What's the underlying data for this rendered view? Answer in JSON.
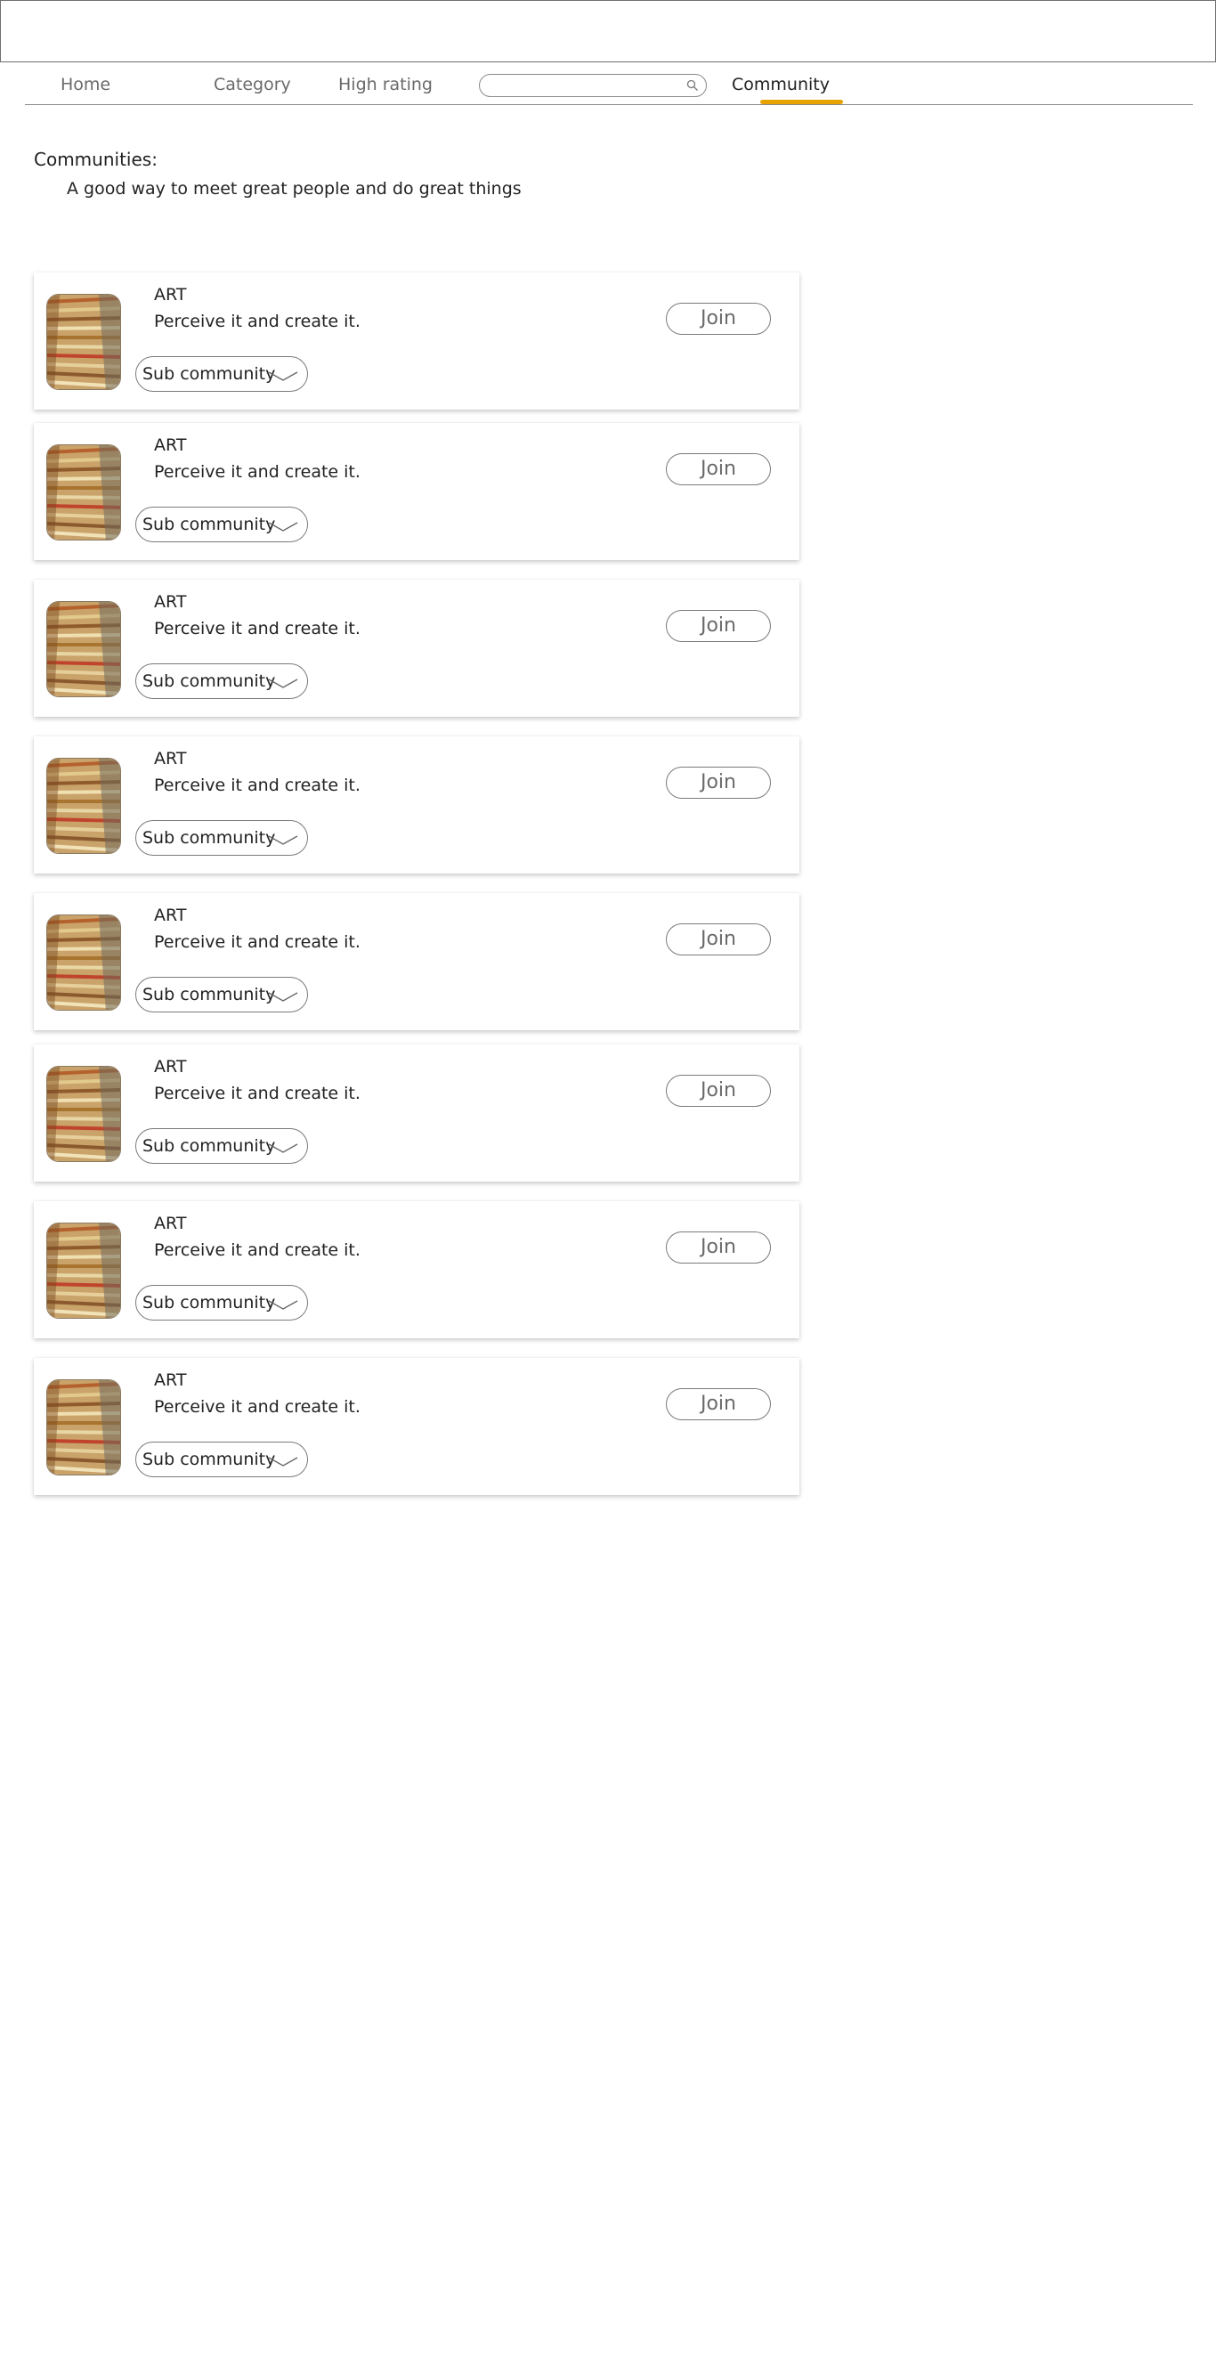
{
  "nav": {
    "items": [
      {
        "label": "Home",
        "active": false
      },
      {
        "label": "Category",
        "active": false
      },
      {
        "label": "High rating",
        "active": false
      },
      {
        "label": "Community",
        "active": true
      }
    ],
    "search": {
      "placeholder": "",
      "value": ""
    },
    "accent_color": "#e8a300"
  },
  "main": {
    "heading": "Communities:",
    "subheading": "A good way to meet great people and do great things"
  },
  "communities": [
    {
      "title": "ART",
      "tagline": "Perceive it and create it.",
      "sub_label": "Sub community",
      "join_label": "Join"
    },
    {
      "title": "ART",
      "tagline": "Perceive it and create it.",
      "sub_label": "Sub community",
      "join_label": "Join"
    },
    {
      "title": "ART",
      "tagline": "Perceive it and create it.",
      "sub_label": "Sub community",
      "join_label": "Join"
    },
    {
      "title": "ART",
      "tagline": "Perceive it and create it.",
      "sub_label": "Sub community",
      "join_label": "Join"
    },
    {
      "title": "ART",
      "tagline": "Perceive it and create it.",
      "sub_label": "Sub community",
      "join_label": "Join"
    },
    {
      "title": "ART",
      "tagline": "Perceive it and create it.",
      "sub_label": "Sub community",
      "join_label": "Join"
    },
    {
      "title": "ART",
      "tagline": "Perceive it and create it.",
      "sub_label": "Sub community",
      "join_label": "Join"
    },
    {
      "title": "ART",
      "tagline": "Perceive it and create it.",
      "sub_label": "Sub community",
      "join_label": "Join"
    }
  ]
}
